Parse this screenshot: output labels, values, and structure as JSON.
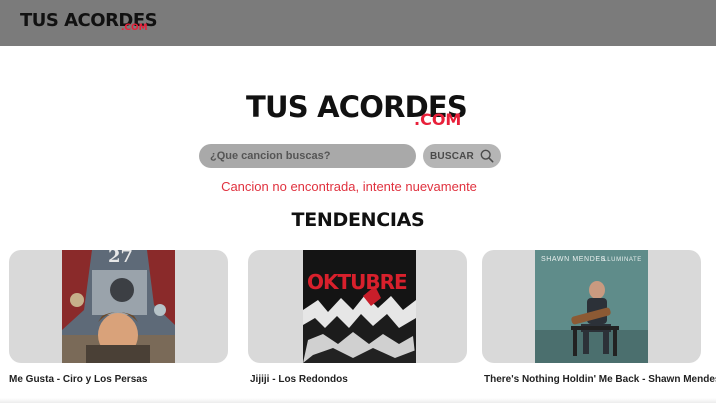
{
  "header": {
    "brand": {
      "name": "TUS ACORDES",
      "suffix": ".COM"
    }
  },
  "hero": {
    "brand": {
      "name": "TUS ACORDES",
      "suffix": ".COM"
    },
    "search": {
      "placeholder": "¿Que cancion buscas?",
      "value": ""
    },
    "search_button_label": "BUSCAR",
    "error_message": "Cancion no encontrada, intente nuevamente"
  },
  "trending": {
    "title": "TENDENCIAS",
    "items": [
      {
        "caption": "Me Gusta - Ciro y Los Persas",
        "cover_text": "27"
      },
      {
        "caption": "Jijiji - Los Redondos",
        "cover_text": "OKTUBRE"
      },
      {
        "caption": "There's Nothing Holdin' Me Back - Shawn Mendes",
        "cover_text": "SHAWN MENDES",
        "cover_subtext": "ILLUMINATE"
      }
    ]
  },
  "colors": {
    "accent": "#e8203a",
    "topbar": "#7b7b7b",
    "card_bg": "#d9d9d9",
    "error": "#e0323f"
  }
}
